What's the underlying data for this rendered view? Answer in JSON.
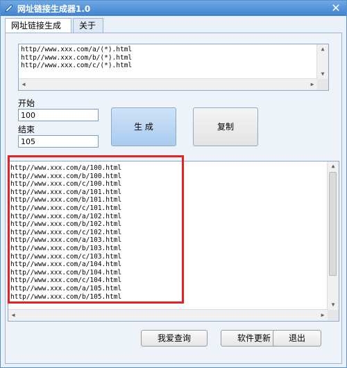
{
  "window": {
    "title": "网址链接生成器1.0",
    "close_label": "✕"
  },
  "tabs": [
    {
      "label": "网址链接生成器"
    },
    {
      "label": "关于"
    }
  ],
  "templates": [
    "http//www.xxx.com/a/(*).html",
    "http//www.xxx.com/b/(*).html",
    "http//www.xxx.com/c/(*).html"
  ],
  "start": {
    "label": "开始",
    "value": "100"
  },
  "end": {
    "label": "结束",
    "value": "105"
  },
  "buttons": {
    "generate": "生 成",
    "copy": "复制",
    "query": "我爱查询",
    "update": "软件更新",
    "exit": "退出"
  },
  "results": [
    "http//www.xxx.com/a/100.html",
    "http//www.xxx.com/b/100.html",
    "http//www.xxx.com/c/100.html",
    "http//www.xxx.com/a/101.html",
    "http//www.xxx.com/b/101.html",
    "http//www.xxx.com/c/101.html",
    "http//www.xxx.com/a/102.html",
    "http//www.xxx.com/b/102.html",
    "http//www.xxx.com/c/102.html",
    "http//www.xxx.com/a/103.html",
    "http//www.xxx.com/b/103.html",
    "http//www.xxx.com/c/103.html",
    "http//www.xxx.com/a/104.html",
    "http//www.xxx.com/b/104.html",
    "http//www.xxx.com/c/104.html",
    "http//www.xxx.com/a/105.html",
    "http//www.xxx.com/b/105.html"
  ],
  "colors": {
    "highlight": "#e52323",
    "title_bar": "#3f82cf"
  }
}
